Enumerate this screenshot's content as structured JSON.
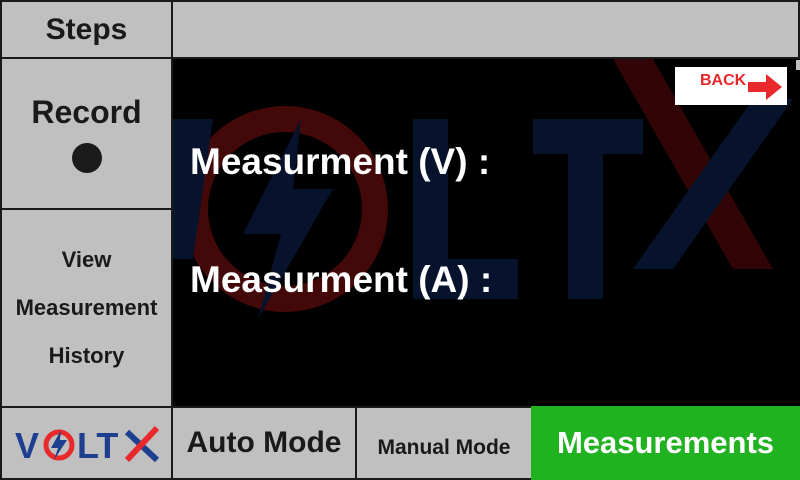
{
  "sidebar": {
    "steps_label": "Steps",
    "record_label": "Record",
    "history_lines": [
      "View",
      "Measurement",
      "History"
    ]
  },
  "brand": {
    "logo_text": "VOLTX",
    "colors": {
      "red": "#e8282a",
      "blue": "#1e3f8f"
    }
  },
  "main": {
    "voltage_label": "Measurment (V) :",
    "current_label": "Measurment (A) :",
    "back_label": "BACK"
  },
  "bottom_nav": {
    "auto_label": "Auto Mode",
    "manual_label": "Manual Mode",
    "measurements_label": "Measurements",
    "active_tab": "Measurements",
    "active_color": "#21b221"
  }
}
